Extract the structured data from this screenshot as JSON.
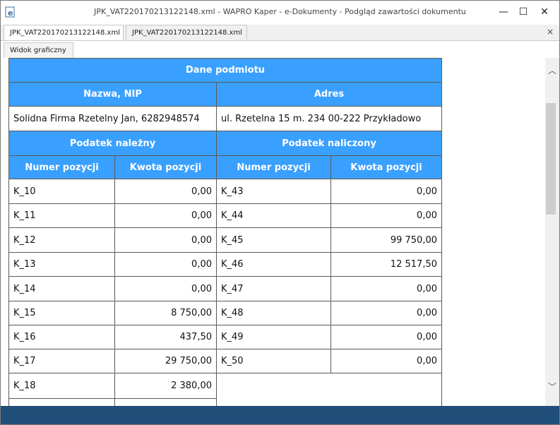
{
  "window": {
    "title": "JPK_VAT220170213122148.xml - WAPRO Kaper - e-Dokumenty - Podgląd zawartości dokumentu",
    "minimize": "—",
    "maximize": "☐",
    "close": "✕"
  },
  "tabs": [
    {
      "label": "JPK_VAT220170213122148.xml"
    },
    {
      "label": "JPK_VAT220170213122148.xml"
    }
  ],
  "tabs_close": "×",
  "subtab": {
    "label": "Widok graficzny"
  },
  "doc": {
    "title": "Dane podmiotu",
    "col_name_nip": "Nazwa, NIP",
    "col_address": "Adres",
    "name_nip": "Solidna Firma Rzetelny Jan, 6282948574",
    "address": "ul. Rzetelna 15  m. 234 00-222 Przykładowo",
    "due_title": "Podatek należny",
    "input_title": "Podatek naliczony",
    "col_pos": "Numer pozycji",
    "col_amount": "Kwota pozycji",
    "left": [
      {
        "pos": "K_10",
        "amount": "0,00"
      },
      {
        "pos": "K_11",
        "amount": "0,00"
      },
      {
        "pos": "K_12",
        "amount": "0,00"
      },
      {
        "pos": "K_13",
        "amount": "0,00"
      },
      {
        "pos": "K_14",
        "amount": "0,00"
      },
      {
        "pos": "K_15",
        "amount": "8 750,00"
      },
      {
        "pos": "K_16",
        "amount": "437,50"
      },
      {
        "pos": "K_17",
        "amount": "29 750,00"
      },
      {
        "pos": "K_18",
        "amount": "2 380,00"
      }
    ],
    "right": [
      {
        "pos": "K_43",
        "amount": "0,00"
      },
      {
        "pos": "K_44",
        "amount": "0,00"
      },
      {
        "pos": "K_45",
        "amount": "99 750,00"
      },
      {
        "pos": "K_46",
        "amount": "12 517,50"
      },
      {
        "pos": "K_47",
        "amount": "0,00"
      },
      {
        "pos": "K_48",
        "amount": "0,00"
      },
      {
        "pos": "K_49",
        "amount": "0,00"
      },
      {
        "pos": "K_50",
        "amount": "0,00"
      }
    ]
  },
  "scroll": {
    "up": "︿",
    "down": "﹀"
  },
  "colors": {
    "header": "#3aa0ff",
    "statusbar": "#1f4e79"
  }
}
